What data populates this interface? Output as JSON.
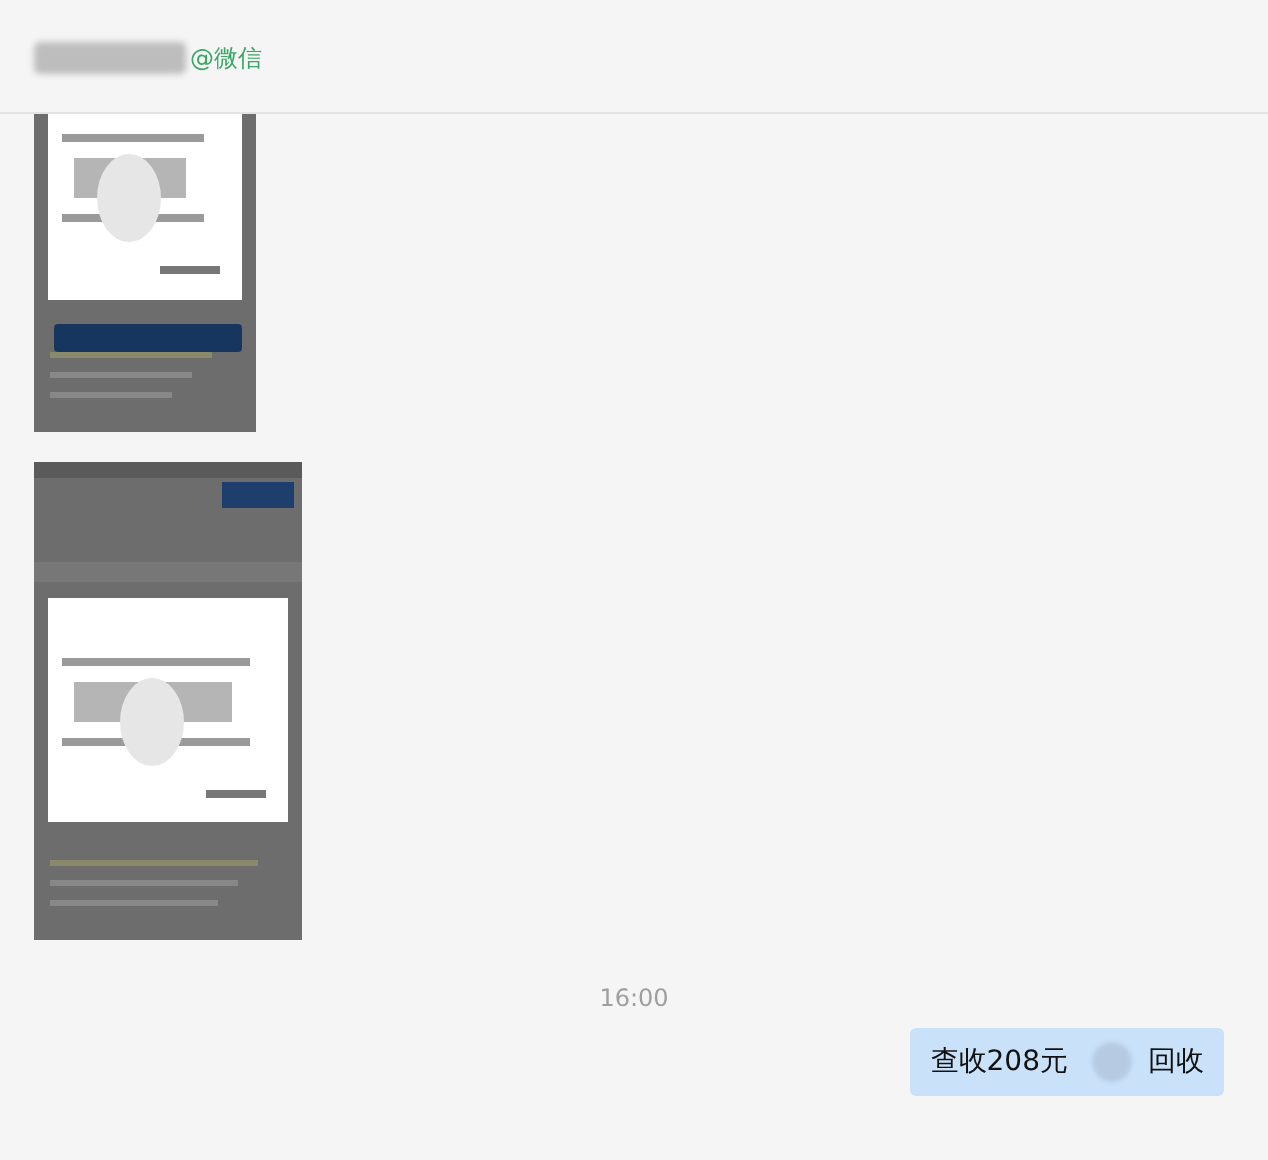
{
  "chat": {
    "name_suffix": "@微信"
  },
  "messages": [
    {
      "kind": "picture"
    },
    {
      "kind": "picture"
    },
    {
      "kind": "time",
      "text": "16:00"
    },
    {
      "kind": "text",
      "parts": [
        "查收208元",
        "回收"
      ]
    }
  ]
}
